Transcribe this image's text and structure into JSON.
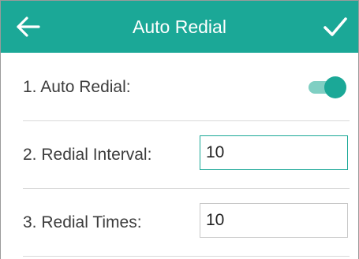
{
  "header": {
    "title": "Auto Redial",
    "back_icon": "arrow-left-icon",
    "confirm_icon": "checkmark-icon",
    "background_color": "#1ba897"
  },
  "settings": {
    "auto_redial": {
      "label": "1. Auto Redial:",
      "enabled": true
    },
    "redial_interval": {
      "label": "2. Redial Interval:",
      "value": "10"
    },
    "redial_times": {
      "label": "3. Redial Times:",
      "value": "10"
    }
  },
  "colors": {
    "accent": "#1ba897",
    "toggle_track": "#7fcfc3"
  }
}
